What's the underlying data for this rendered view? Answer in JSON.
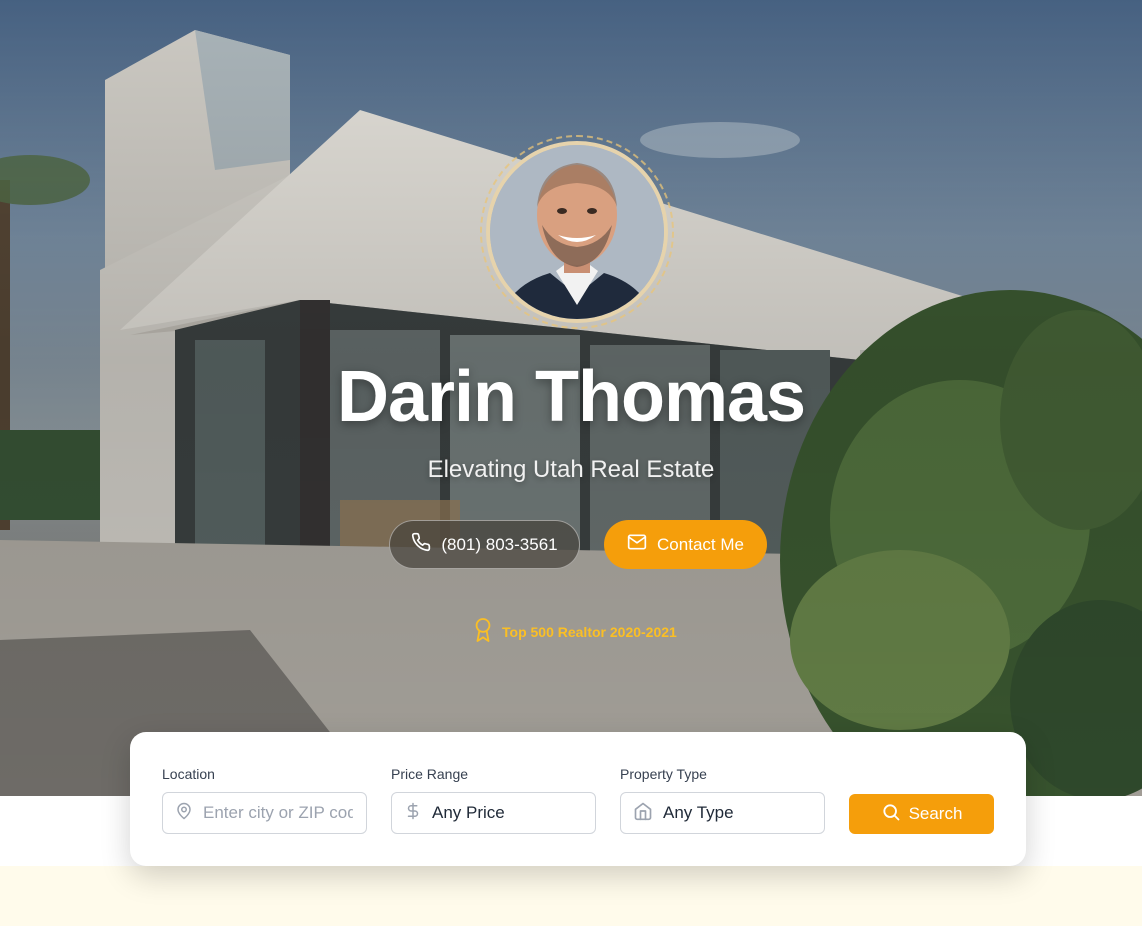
{
  "agent": {
    "name": "Darin Thomas",
    "tagline": "Elevating Utah Real Estate",
    "phone_label": "(801) 803-3561",
    "contact_label": "Contact Me",
    "award": "Top 500 Realtor 2020-2021"
  },
  "search": {
    "location_label": "Location",
    "location_placeholder": "Enter city or ZIP code",
    "price_label": "Price Range",
    "price_value": "Any Price",
    "type_label": "Property Type",
    "type_value": "Any Type",
    "search_label": "Search"
  },
  "colors": {
    "accent": "#f59e0b",
    "award": "#fbbf24",
    "band": "#fffbeb"
  },
  "icons": [
    "phone-icon",
    "mail-icon",
    "award-icon",
    "map-pin-icon",
    "dollar-icon",
    "home-icon",
    "search-icon"
  ]
}
